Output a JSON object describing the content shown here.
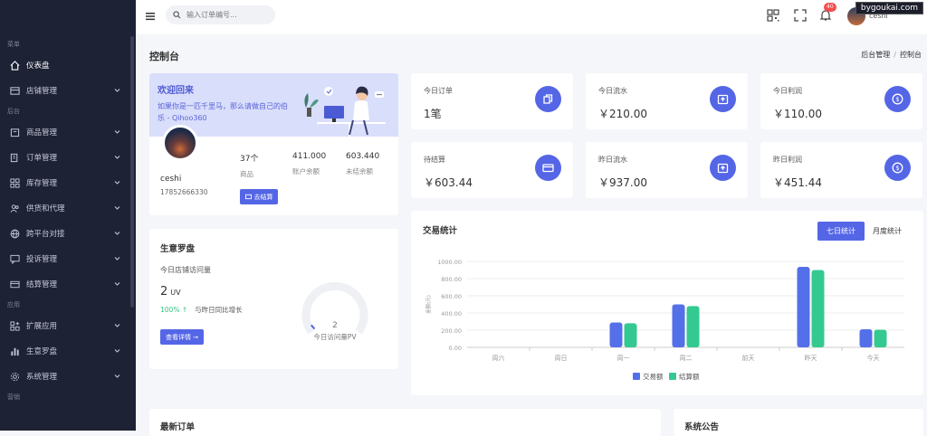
{
  "watermark": "bygoukai.com",
  "sidebar": {
    "groups": [
      {
        "label": "菜单",
        "items": [
          {
            "label": "仪表盘",
            "icon": "home-icon",
            "active": true
          },
          {
            "label": "店铺管理",
            "icon": "store-icon",
            "chevron": true
          }
        ]
      },
      {
        "label": "后台",
        "items": [
          {
            "label": "商品管理",
            "icon": "box-icon",
            "chevron": true
          },
          {
            "label": "订单管理",
            "icon": "order-icon",
            "chevron": true
          },
          {
            "label": "库存管理",
            "icon": "grid-icon",
            "chevron": true
          },
          {
            "label": "供货和代理",
            "icon": "users-icon",
            "chevron": true
          },
          {
            "label": "跨平台对接",
            "icon": "globe-icon",
            "chevron": true
          },
          {
            "label": "投诉管理",
            "icon": "message-icon",
            "chevron": true
          },
          {
            "label": "结算管理",
            "icon": "card-icon",
            "chevron": true
          }
        ]
      },
      {
        "label": "应用",
        "items": [
          {
            "label": "扩展应用",
            "icon": "apps-icon",
            "chevron": true
          },
          {
            "label": "生意罗盘",
            "icon": "bar-chart-icon",
            "chevron": true
          },
          {
            "label": "系统管理",
            "icon": "gear-icon",
            "chevron": true
          }
        ]
      },
      {
        "label": "营销",
        "items": []
      }
    ]
  },
  "topbar": {
    "search_placeholder": "输入订单编号...",
    "notification_count": "40",
    "username": "ceshi"
  },
  "page": {
    "title": "控制台",
    "breadcrumb": [
      "后台管理",
      "控制台"
    ]
  },
  "welcome": {
    "title": "欢迎回来",
    "subtitle": "如果你是一匹千里马，那么请做自己的伯乐 - Qihoo360",
    "name": "ceshi",
    "phone": "17852666330",
    "stats": [
      {
        "value": "37个",
        "label": "商品"
      },
      {
        "value": "411.000",
        "label": "账户余额"
      },
      {
        "value": "603.440",
        "label": "未结余额"
      }
    ],
    "settle_button": "去结算"
  },
  "metrics": [
    {
      "title": "今日订单",
      "value": "1笔",
      "icon": "copy-icon"
    },
    {
      "title": "今日流水",
      "value": "￥210.00",
      "icon": "upload-box-icon"
    },
    {
      "title": "今日利润",
      "value": "￥110.00",
      "icon": "dollar-icon"
    },
    {
      "title": "待结算",
      "value": "￥603.44",
      "icon": "credit-card-icon"
    },
    {
      "title": "昨日流水",
      "value": "￥937.00",
      "icon": "upload-box-icon"
    },
    {
      "title": "昨日利润",
      "value": "￥451.44",
      "icon": "dollar-icon"
    }
  ],
  "compass": {
    "title": "生意罗盘",
    "subtitle": "今日店铺访问量",
    "uv_value": "2",
    "uv_unit": "UV",
    "growth_value": "100% ↑",
    "growth_text": "与昨日同比增长",
    "button": "查看详情 →",
    "gauge_value": "2",
    "gauge_fraction": 0.02,
    "gauge_label": "今日访问量PV"
  },
  "trade": {
    "title": "交易统计",
    "tabs": [
      "七日统计",
      "月度统计"
    ]
  },
  "chart_data": {
    "type": "bar",
    "categories": [
      "周六",
      "周日",
      "周一",
      "周二",
      "前天",
      "昨天",
      "今天"
    ],
    "series": [
      {
        "name": "交易额",
        "color": "#5470e8",
        "values": [
          0,
          0,
          290,
          500,
          0,
          937,
          210
        ]
      },
      {
        "name": "结算额",
        "color": "#34c990",
        "values": [
          0,
          0,
          280,
          480,
          0,
          900,
          205
        ]
      }
    ],
    "ylabel": "金额(元)",
    "ylim": [
      0,
      1000
    ],
    "yticks": [
      "0.00",
      "200.00",
      "400.00",
      "600.00",
      "800.00",
      "1000.00"
    ],
    "legend": "bottom",
    "grid": true
  },
  "bottom": {
    "orders_title": "最新订单",
    "notice_title": "系统公告"
  }
}
